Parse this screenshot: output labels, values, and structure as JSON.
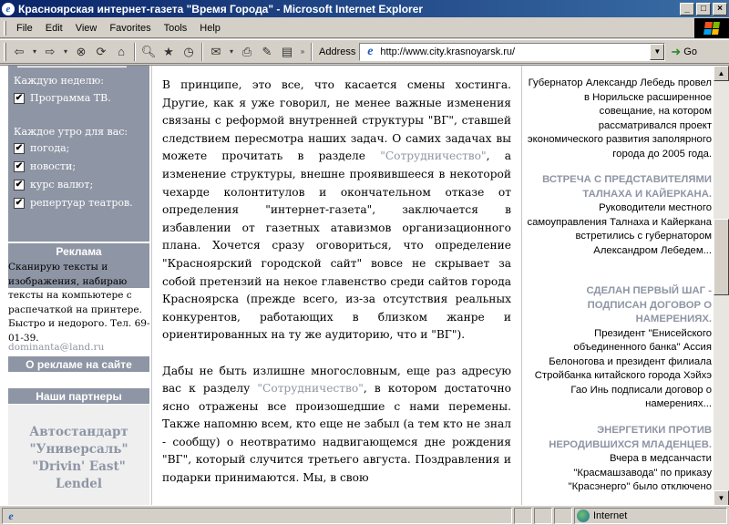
{
  "window": {
    "title": "Красноярская интернет-газета \"Время Города\" - Microsoft Internet Explorer",
    "buttons": {
      "minimize": "_",
      "maximize": "□",
      "close": "×"
    }
  },
  "menu": [
    {
      "label": "File"
    },
    {
      "label": "Edit"
    },
    {
      "label": "View"
    },
    {
      "label": "Favorites"
    },
    {
      "label": "Tools"
    },
    {
      "label": "Help"
    }
  ],
  "toolbar": {
    "address_label": "Address",
    "url": "http://www.city.krasnoyarsk.ru/",
    "go_label": "Go"
  },
  "left": {
    "subscribe": {
      "weekly_heading": "Каждую неделю:",
      "weekly_items": [
        {
          "label": "Программа ТВ.",
          "checked": true
        }
      ],
      "daily_heading": "Каждое утро для вас:",
      "daily_items": [
        {
          "label": "погода;",
          "checked": true
        },
        {
          "label": "новости;",
          "checked": true
        },
        {
          "label": "курс валют;",
          "checked": true
        },
        {
          "label": "репертуар театров.",
          "checked": true
        }
      ]
    },
    "ads": {
      "header": "Реклама",
      "text": "Сканирую тексты и изображения, набираю тексты на компьютере с распечаткой на принтере. Быстро и недорого. Тел. 69-01-39.",
      "email": "dominanta@land.ru",
      "about_link": "О рекламе на сайте"
    },
    "partners": {
      "header": "Наши партнеры",
      "items": [
        "Автостандарт",
        "\"Универсаль\"",
        "\"Drivin' East\"",
        "Lendel"
      ]
    }
  },
  "main": {
    "p1_before": "В принципе, это все, что касается смены хостинга. Другие, как я уже говорил, не менее важные изменения связаны с реформой внутренней структуры \"ВГ\", ставшей следствием пересмотра наших задач. О самих задачах вы можете прочитать в разделе ",
    "p1_link": "\"Сотрудничество\"",
    "p1_after": ", а изменение структуры, внешне проявившееся в некоторой чехарде колонтитулов и окончательном отказе от определения \"интернет-газета\", заключается в избавлении от газетных атавизмов организационного плана. Хочется сразу оговориться, что определение \"Красноярский городской сайт\" вовсе не скрывает за собой претензий на некое главенство среди сайтов города Красноярска (прежде всего, из-за отсутствия реальных конкурентов, работающих в близком жанре и ориентированных на ту же аудиторию, что и \"ВГ\").",
    "p2_before": "Дабы не быть излишне многословным, еще раз адресую вас к разделу ",
    "p2_link": "\"Сотрудничество\"",
    "p2_after": ", в котором достаточно ясно отражены все произошедшие с нами перемены. Также напомню всем, кто еще не забыл (а тем кто не знал - сообщу) о неотвратимо надвигающемся дне рождения \"ВГ\", который случится третьего августа. Поздравления и подарки принимаются. Мы, в свою"
  },
  "news": [
    {
      "title": "",
      "text": "Губернатор Александр Лебедь провел в Норильске расширенное совещание, на котором рассматривался проект экономического развития заполярного города до 2005 года."
    },
    {
      "title": "ВСТРЕЧА С ПРЕДСТАВИТЕЛЯМИ ТАЛНАХА И КАЙЕРКАНА.",
      "text": "Руководители местного самоуправления Талнаха и Кайеркана встретились с губернатором Александром Лебедем..."
    },
    {
      "title": "СДЕЛАН ПЕРВЫЙ ШАГ - ПОДПИСАН ДОГОВОР О НАМЕРЕНИЯХ.",
      "text": "Президент \"Енисейского объединенного банка\" Ассия Белоногова и президент филиала Стройбанка китайского города Хэйхэ Гао Инь подписали договор о намерениях..."
    },
    {
      "title": "ЭНЕРГЕТИКИ ПРОТИВ НЕРОДИВШИХСЯ МЛАДЕНЦЕВ.",
      "text": "Вчера в медсанчасти \"Красмашзавода\" по приказу \"Красэнерго\" было отключено"
    }
  ],
  "status": {
    "zone": "Internet"
  }
}
